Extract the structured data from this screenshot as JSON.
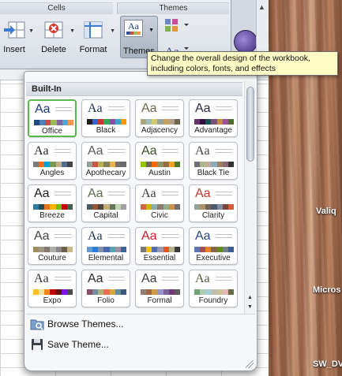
{
  "ribbon": {
    "cells_group_label": "Cells",
    "themes_group_label": "Themes",
    "insert_label": "Insert",
    "delete_label": "Delete",
    "format_label": "Format",
    "themes_label": "Themes"
  },
  "tooltip": {
    "text": "Change the overall design of the workbook, including colors, fonts, and effects"
  },
  "panel": {
    "section_label": "Built-In",
    "browse_label": "Browse Themes...",
    "save_label": "Save Theme..."
  },
  "themes": [
    {
      "name": "Office",
      "aa_color": "#1f3a72",
      "swatches": [
        "#1f497d",
        "#4f81bd",
        "#c0504d",
        "#9bbb59",
        "#8064a2",
        "#4bacc6",
        "#f79646"
      ]
    },
    {
      "name": "Black",
      "aa_color": "#1b2f58",
      "swatches": [
        "#1d1d1d",
        "#3366cc",
        "#cc3333",
        "#33aa55",
        "#9944aa",
        "#33aacc",
        "#ff9900"
      ]
    },
    {
      "name": "Adjacency",
      "aa_color": "#6e6651",
      "swatches": [
        "#a9a57c",
        "#9cbebd",
        "#d2cb6c",
        "#95a39d",
        "#c89f5d",
        "#b1a089",
        "#6e6651"
      ]
    },
    {
      "name": "Advantage",
      "aa_color": "#2f2b3f",
      "swatches": [
        "#663366",
        "#330f42",
        "#1e5155",
        "#7f4f80",
        "#c28a3e",
        "#a04da3",
        "#4e6a2c"
      ]
    },
    {
      "name": "Angles",
      "aa_color": "#232323",
      "swatches": [
        "#797b7e",
        "#f96a1b",
        "#08a1d9",
        "#7c984a",
        "#c2ad8d",
        "#506e94",
        "#444444"
      ]
    },
    {
      "name": "Apothecary",
      "aa_color": "#5a5a5a",
      "swatches": [
        "#93a299",
        "#cf543f",
        "#b5ae53",
        "#848058",
        "#e8b54d",
        "#786c71",
        "#6a6a6a"
      ]
    },
    {
      "name": "Austin",
      "aa_color": "#3a4a2a",
      "swatches": [
        "#94c600",
        "#71685a",
        "#ff6700",
        "#909465",
        "#956b43",
        "#fea022",
        "#4d7a2a"
      ]
    },
    {
      "name": "Black Tie",
      "aa_color": "#444444",
      "swatches": [
        "#6f6f74",
        "#a7b789",
        "#beae98",
        "#92a9b9",
        "#9c8265",
        "#8d6974",
        "#333333"
      ]
    },
    {
      "name": "Breeze",
      "aa_color": "#1a1a1a",
      "swatches": [
        "#2c7c9f",
        "#244a58",
        "#e2751d",
        "#ffb400",
        "#7eb606",
        "#c00000",
        "#455f51"
      ]
    },
    {
      "name": "Capital",
      "aa_color": "#5b6b4c",
      "swatches": [
        "#4b5a60",
        "#9c5238",
        "#504539",
        "#c1ad79",
        "#667559",
        "#bad6ad",
        "#a1a1a1"
      ]
    },
    {
      "name": "Civic",
      "aa_color": "#3a3a3a",
      "swatches": [
        "#d16349",
        "#ccb400",
        "#8cadae",
        "#8c7b70",
        "#8fb08c",
        "#d19049",
        "#6d6d6d"
      ]
    },
    {
      "name": "Clarity",
      "aa_color": "#c0392b",
      "swatches": [
        "#93a299",
        "#ad8f67",
        "#726056",
        "#4c5a6a",
        "#808da0",
        "#79463d",
        "#d35a3c"
      ]
    },
    {
      "name": "Couture",
      "aa_color": "#444444",
      "swatches": [
        "#9e8e5c",
        "#a09781",
        "#85776d",
        "#aeafa9",
        "#8d878b",
        "#6b6149",
        "#c8b884"
      ]
    },
    {
      "name": "Elemental",
      "aa_color": "#1d2d4a",
      "swatches": [
        "#629dd1",
        "#297fd5",
        "#7f8fa9",
        "#4a66ac",
        "#5aa2ae",
        "#9d90a0",
        "#3b6398"
      ]
    },
    {
      "name": "Essential",
      "aa_color": "#d01b2a",
      "swatches": [
        "#7a7a7a",
        "#f5c201",
        "#526db0",
        "#989aac",
        "#dc5924",
        "#b4b392",
        "#3a3a3a"
      ]
    },
    {
      "name": "Executive",
      "aa_color": "#2b4b7a",
      "swatches": [
        "#6076b4",
        "#9c5252",
        "#e68422",
        "#846648",
        "#63891f",
        "#758085",
        "#3f5b93"
      ]
    },
    {
      "name": "Expo",
      "aa_color": "#333333",
      "swatches": [
        "#fbc01e",
        "#efe1a2",
        "#fa8716",
        "#be0204",
        "#640f10",
        "#7e13e3",
        "#4a4a4a"
      ]
    },
    {
      "name": "Folio",
      "aa_color": "#2a2a2a",
      "swatches": [
        "#884f6b",
        "#758da3",
        "#a9b47b",
        "#ec6d52",
        "#d8a53b",
        "#5f8ea0",
        "#3d5a7a"
      ]
    },
    {
      "name": "Formal",
      "aa_color": "#3d3d3d",
      "swatches": [
        "#907f76",
        "#a46645",
        "#cd9c47",
        "#9a92cd",
        "#7d639b",
        "#733678",
        "#5c5c5c"
      ]
    },
    {
      "name": "Foundry",
      "aa_color": "#4f5a3a",
      "swatches": [
        "#72a376",
        "#b0ccb0",
        "#a8cdd7",
        "#c0beaf",
        "#cec597",
        "#e8b7b7",
        "#6b6b4a"
      ]
    }
  ]
}
